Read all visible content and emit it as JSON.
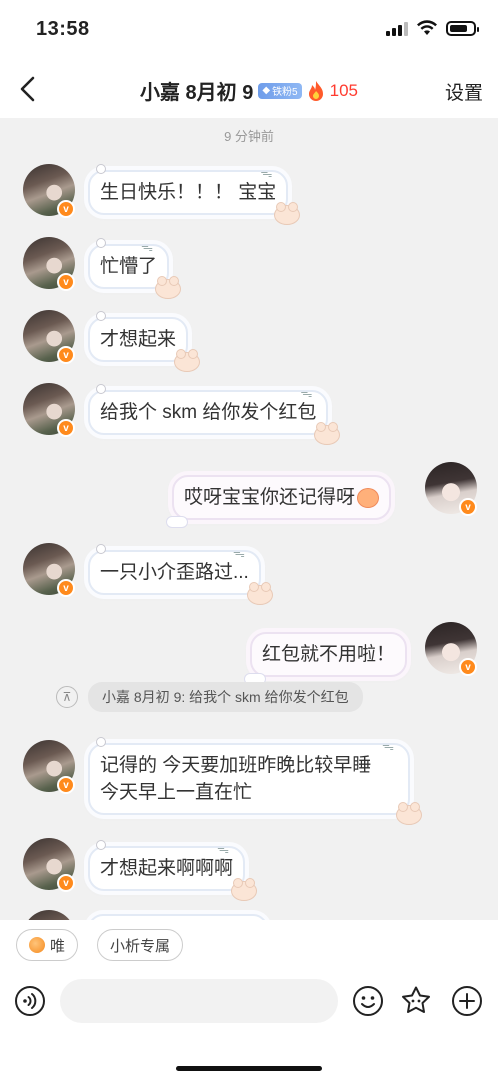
{
  "status": {
    "time": "13:58"
  },
  "header": {
    "title": "小嘉 8月初 9",
    "fan_badge": "铁粉5",
    "fire_count": "105",
    "settings_label": "设置"
  },
  "chat": {
    "timestamp": "9 分钟前",
    "messages": [
      {
        "side": "left",
        "text": "生日快乐！！！ 宝宝"
      },
      {
        "side": "left",
        "text": "忙懵了"
      },
      {
        "side": "left",
        "text": "才想起来"
      },
      {
        "side": "left",
        "text": "给我个 skm 给你发个红包"
      },
      {
        "side": "right",
        "text": "哎呀宝宝你还记得呀"
      },
      {
        "side": "left",
        "text": "一只小介歪路过..."
      },
      {
        "side": "right",
        "text": "红包就不用啦！"
      },
      {
        "side": "left",
        "text": "记得的 今天要加班昨晚比较早睡",
        "text2": "今天早上一直在忙"
      },
      {
        "side": "left",
        "text": "才想起来啊啊啊"
      }
    ],
    "quote": "小嘉 8月初 9: 给我个 skm 给你发个红包",
    "avatar_badge": "v"
  },
  "bottom": {
    "chips": [
      "唯",
      "小析专属"
    ],
    "input_placeholder": ""
  }
}
